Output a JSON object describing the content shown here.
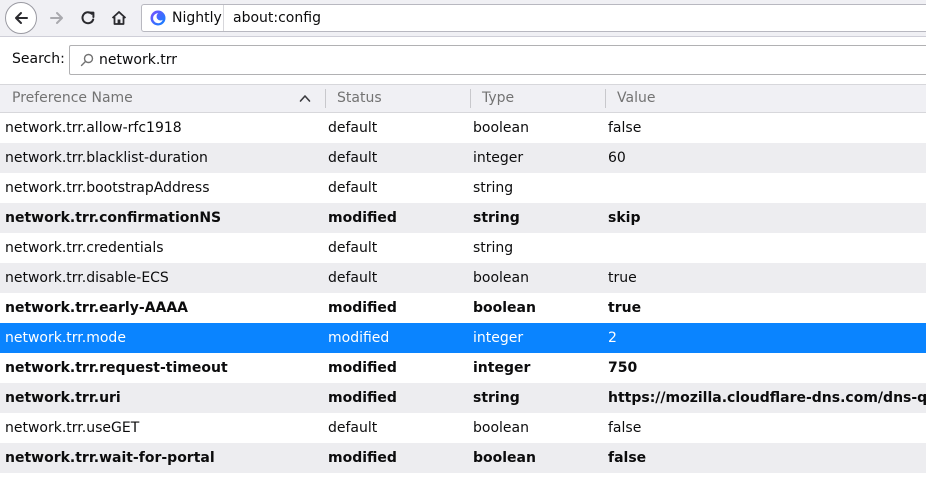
{
  "toolbar": {
    "brand": "Nightly",
    "url": "about:config"
  },
  "search": {
    "label": "Search:",
    "value": "network.trr"
  },
  "table": {
    "columns": {
      "name": "Preference Name",
      "status": "Status",
      "type": "Type",
      "value": "Value"
    },
    "sort_icon": "chevron-up-icon",
    "rows": [
      {
        "name": "network.trr.allow-rfc1918",
        "status": "default",
        "type": "boolean",
        "value": "false",
        "modified": false,
        "selected": false
      },
      {
        "name": "network.trr.blacklist-duration",
        "status": "default",
        "type": "integer",
        "value": "60",
        "modified": false,
        "selected": false
      },
      {
        "name": "network.trr.bootstrapAddress",
        "status": "default",
        "type": "string",
        "value": "",
        "modified": false,
        "selected": false
      },
      {
        "name": "network.trr.confirmationNS",
        "status": "modified",
        "type": "string",
        "value": "skip",
        "modified": true,
        "selected": false
      },
      {
        "name": "network.trr.credentials",
        "status": "default",
        "type": "string",
        "value": "",
        "modified": false,
        "selected": false
      },
      {
        "name": "network.trr.disable-ECS",
        "status": "default",
        "type": "boolean",
        "value": "true",
        "modified": false,
        "selected": false
      },
      {
        "name": "network.trr.early-AAAA",
        "status": "modified",
        "type": "boolean",
        "value": "true",
        "modified": true,
        "selected": false
      },
      {
        "name": "network.trr.mode",
        "status": "modified",
        "type": "integer",
        "value": "2",
        "modified": false,
        "selected": true
      },
      {
        "name": "network.trr.request-timeout",
        "status": "modified",
        "type": "integer",
        "value": "750",
        "modified": true,
        "selected": false
      },
      {
        "name": "network.trr.uri",
        "status": "modified",
        "type": "string",
        "value": "https://mozilla.cloudflare-dns.com/dns-query",
        "modified": true,
        "selected": false
      },
      {
        "name": "network.trr.useGET",
        "status": "default",
        "type": "boolean",
        "value": "false",
        "modified": false,
        "selected": false
      },
      {
        "name": "network.trr.wait-for-portal",
        "status": "modified",
        "type": "boolean",
        "value": "false",
        "modified": true,
        "selected": false
      }
    ]
  },
  "colors": {
    "selection": "#0a84ff",
    "alt_row": "#ededf0",
    "header_bg": "#f0f0f4"
  }
}
